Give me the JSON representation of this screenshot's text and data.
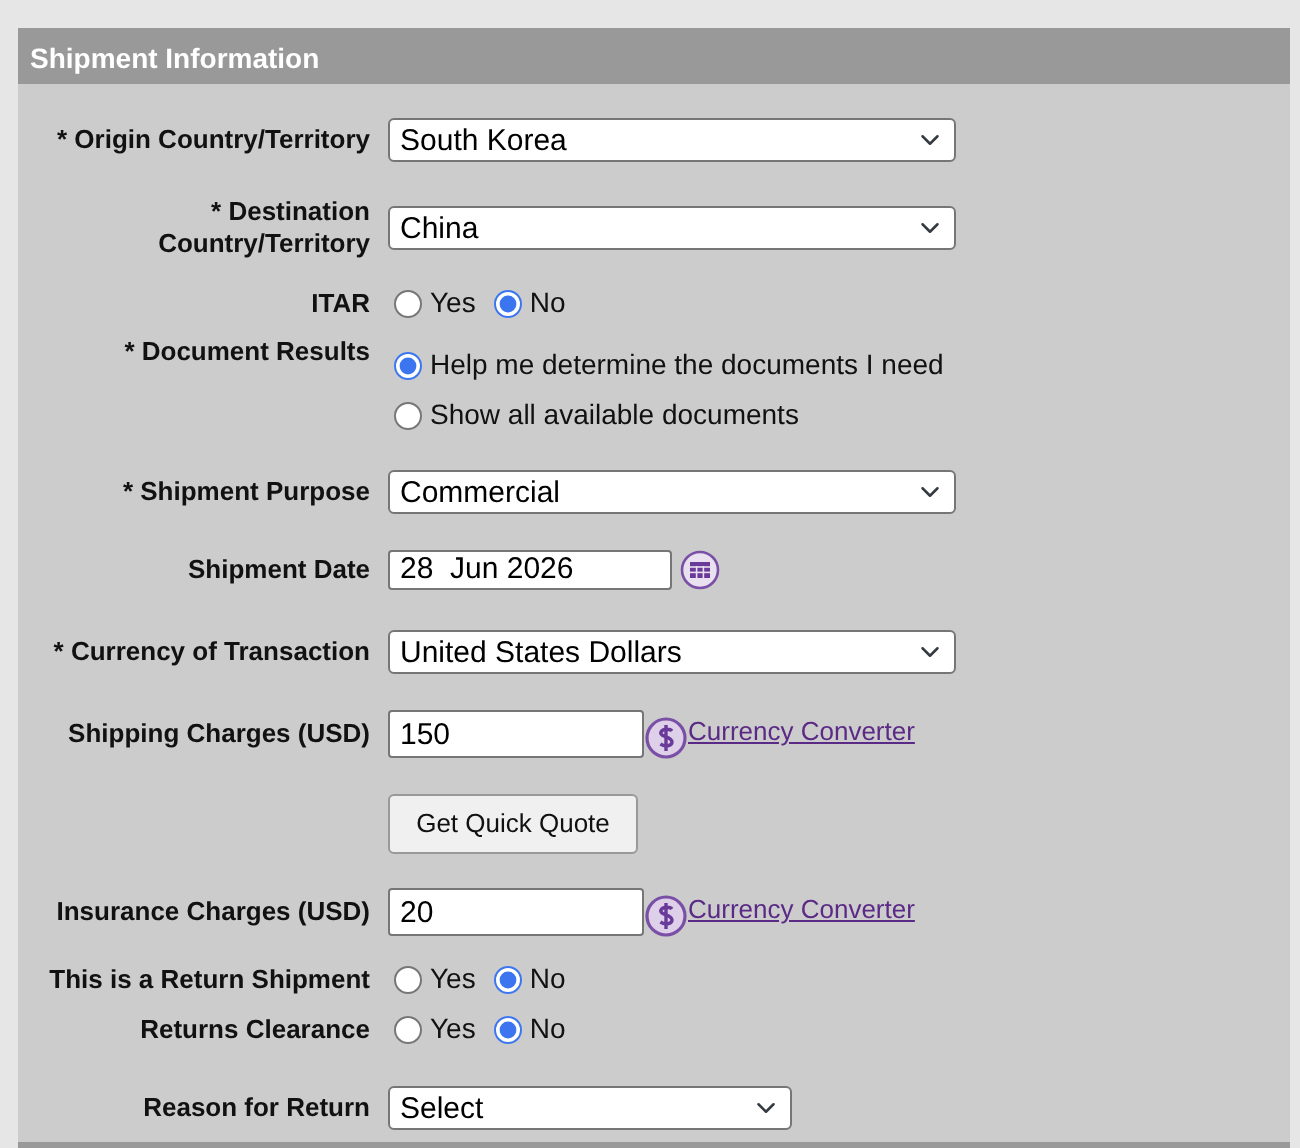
{
  "header": {
    "title": "Shipment Information"
  },
  "fields": [
    {
      "kind": "select",
      "label": "* Origin Country/Territory",
      "value": "South Korea"
    },
    {
      "kind": "select",
      "label": "* Destination Country/Territory",
      "value": "China"
    },
    {
      "kind": "radio-inline",
      "label": "ITAR",
      "options": [
        {
          "label": "Yes",
          "selected": false
        },
        {
          "label": "No",
          "selected": true
        }
      ]
    },
    {
      "kind": "radio-list",
      "label": "* Document Results",
      "options": [
        {
          "label": "Help me determine the documents I need",
          "selected": true
        },
        {
          "label": "Show all available documents",
          "selected": false
        }
      ]
    },
    {
      "kind": "select",
      "label": "* Shipment Purpose",
      "value": "Commercial"
    },
    {
      "kind": "date",
      "label": "Shipment Date",
      "value": "28  Jun 2026"
    },
    {
      "kind": "select",
      "label": "* Currency of Transaction",
      "value": "United States Dollars"
    },
    {
      "kind": "amount",
      "label": "Shipping Charges (USD)",
      "value": "150",
      "link": "Currency Converter"
    },
    {
      "kind": "button",
      "text": "Get Quick Quote"
    },
    {
      "kind": "amount",
      "label": "Insurance Charges (USD)",
      "value": "20",
      "link": "Currency Converter"
    },
    {
      "kind": "radio-inline",
      "label": "This is a Return Shipment",
      "options": [
        {
          "label": "Yes",
          "selected": false
        },
        {
          "label": "No",
          "selected": true
        }
      ]
    },
    {
      "kind": "radio-inline",
      "label": "Returns Clearance",
      "options": [
        {
          "label": "Yes",
          "selected": false
        },
        {
          "label": "No",
          "selected": true
        }
      ]
    },
    {
      "kind": "select-short",
      "label": "Reason for Return",
      "value": "Select"
    }
  ]
}
